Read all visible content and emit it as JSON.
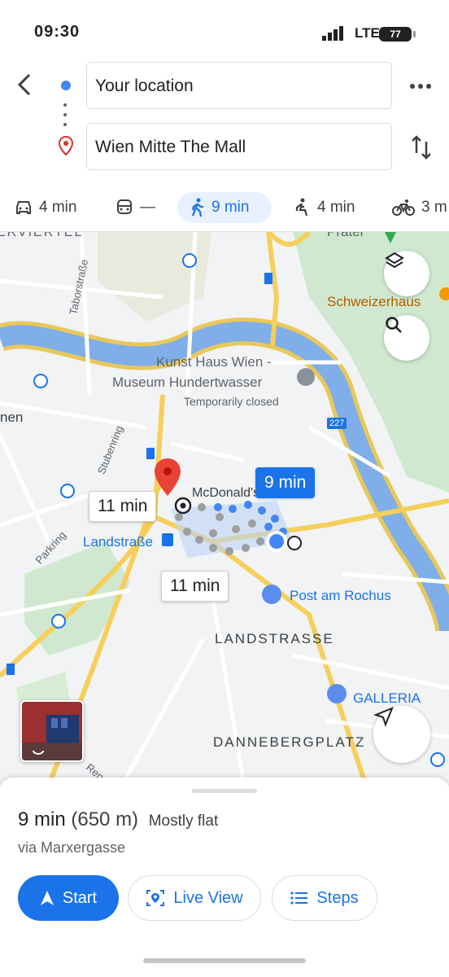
{
  "status": {
    "time": "09:30",
    "network": "LTE",
    "battery": "77"
  },
  "search": {
    "origin": "Your location",
    "destination": "Wien Mitte The Mall"
  },
  "modes": [
    {
      "icon": "car-icon",
      "label": "4 min"
    },
    {
      "icon": "transit-icon",
      "label": "—"
    },
    {
      "icon": "walk-icon",
      "label": "9 min",
      "active": true
    },
    {
      "icon": "wheelchair-icon",
      "label": "4 min"
    },
    {
      "icon": "bike-icon",
      "label": "3 m"
    }
  ],
  "map": {
    "labels": {
      "district_top": "ERVIERTEL",
      "prater": "Prater",
      "taborstrasse": "Taborstraße",
      "schweizerhaus": "Schweizerhaus",
      "kunsthaus_line1": "Kunst Haus Wien -",
      "kunsthaus_line2": "Museum Hundertwasser",
      "kunsthaus_status": "Temporarily closed",
      "nen": "nen",
      "stubenring": "Stubenring",
      "mcdonalds": "McDonald's Wien",
      "landstrasse_station": "Landstraße",
      "parkring": "Parkring",
      "post": "Post am Rochus",
      "landstrasse_district": "LANDSTRASSE",
      "galleria": "GALLERIA",
      "dannebergplatz": "DANNEBERGPLATZ",
      "renn": "Renn",
      "road_227": "227"
    },
    "bubbles": {
      "walk": "9 min",
      "alt1": "11 min",
      "alt2": "11 min"
    },
    "colors": {
      "river": "#6fa4e8",
      "road_major": "#fbd34f",
      "park": "#c8e6c9",
      "route": "#4285f4"
    }
  },
  "route": {
    "duration": "9 min",
    "distance": "(650 m)",
    "terrain": "Mostly flat",
    "via": "via Marxergasse"
  },
  "actions": {
    "start": "Start",
    "live_view": "Live View",
    "steps": "Steps"
  }
}
